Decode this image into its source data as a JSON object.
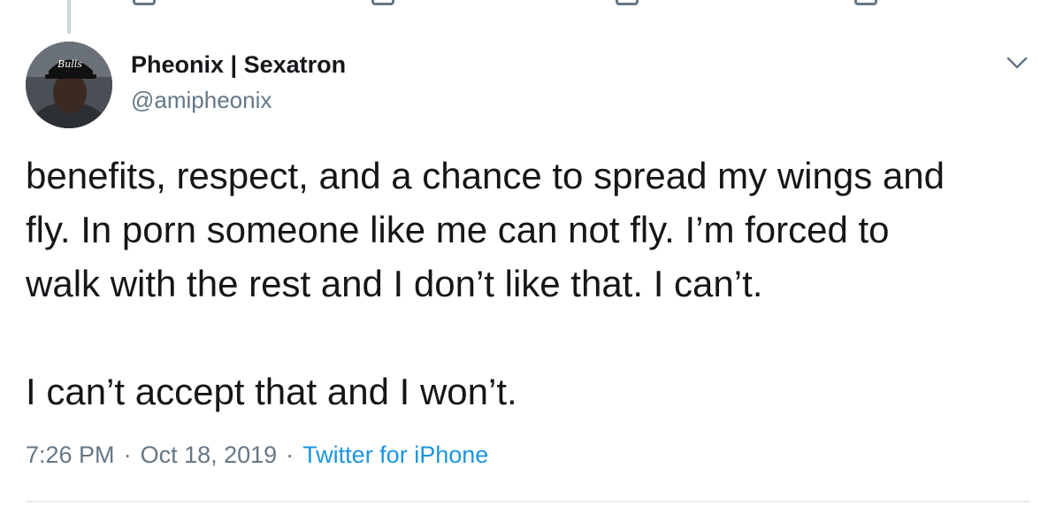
{
  "author": {
    "display_name": "Pheonix | Sexatron",
    "handle": "@amipheonix",
    "avatar_cap_text": "Bulls"
  },
  "tweet": {
    "lines_para1": [
      "benefits, respect, and a chance to spread my wings and",
      "fly. In porn someone like me can not fly. I’m forced to",
      "walk with the rest and I don’t like that. I can’t."
    ],
    "line_para2": "I can’t accept that and I won’t."
  },
  "meta": {
    "time": "7:26 PM",
    "date": "Oct 18, 2019",
    "separator": "·",
    "source": "Twitter for iPhone"
  },
  "colors": {
    "text": "#14171a",
    "secondary": "#657786",
    "link": "#1b95e0",
    "divider": "#e6ecf0",
    "thread_line": "#ccd6dd"
  },
  "icons": {
    "more": "chevron-down-icon"
  }
}
